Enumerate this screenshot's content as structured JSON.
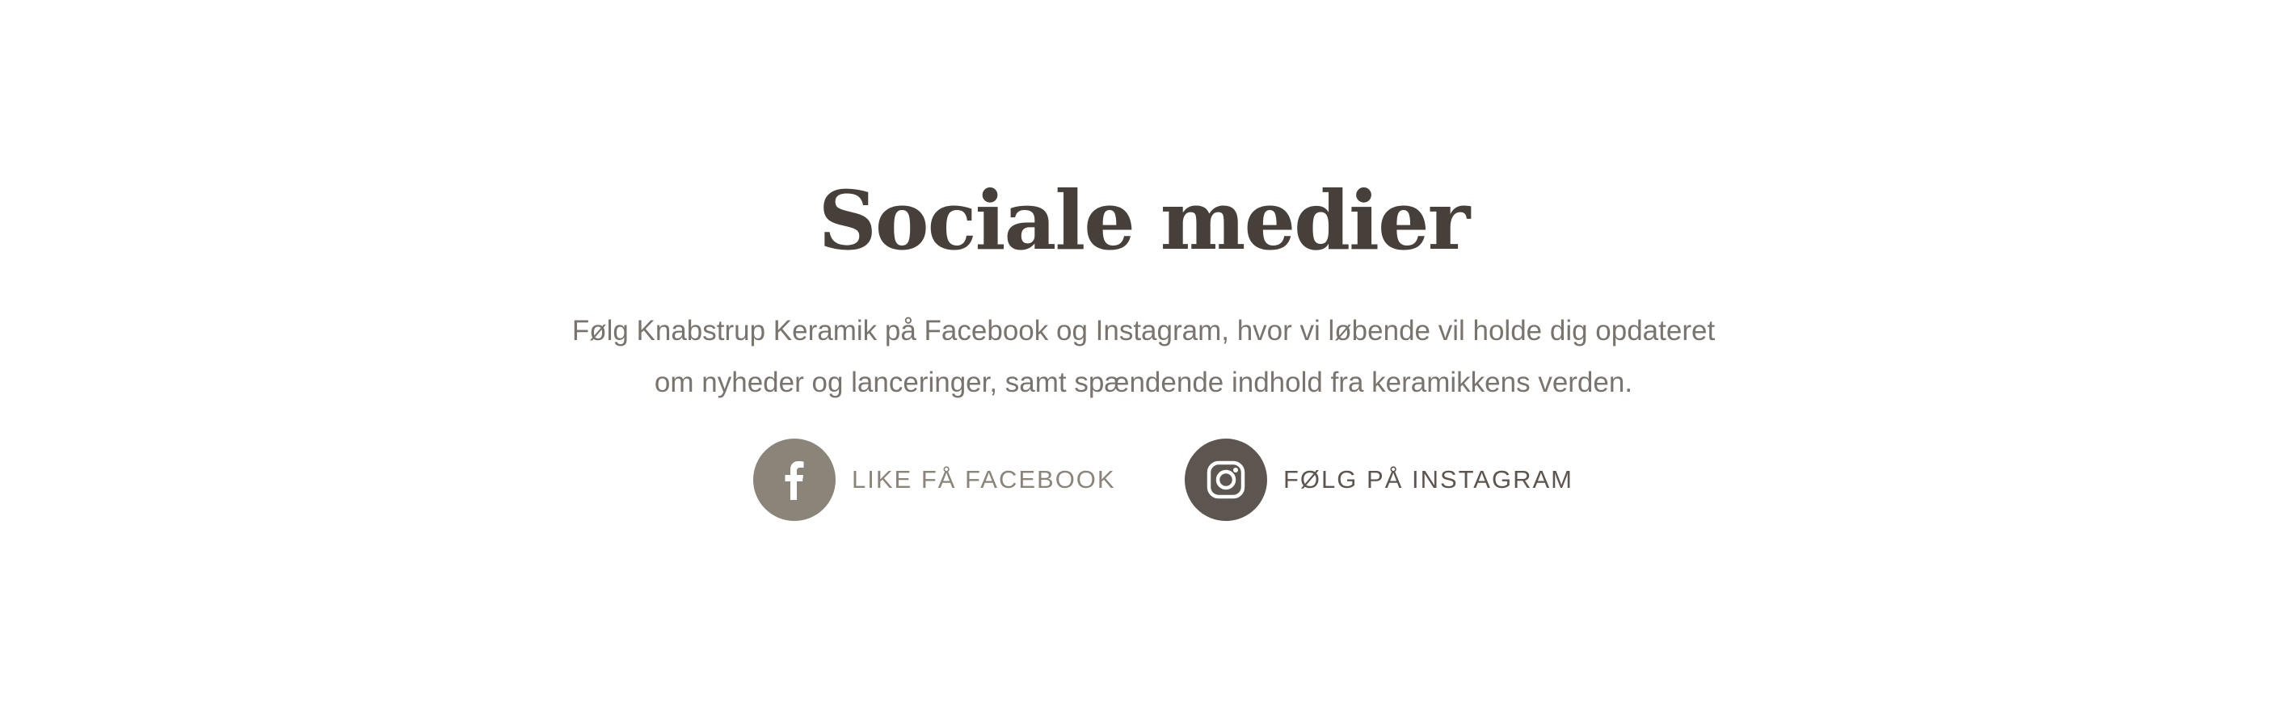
{
  "social": {
    "title": "Sociale medier",
    "description_lines": [
      "Følg Knabstrup Keramik på Facebook og Instagram, hvor vi løbende vil holde dig opdateret",
      "om nyheder og lanceringer, samt spændende indhold fra keramikkens verden."
    ],
    "links": [
      {
        "label": "LIKE FÅ FACEBOOK",
        "icon": "facebook-icon",
        "color": "#8a8479"
      },
      {
        "label": "FØLG PÅ INSTAGRAM",
        "icon": "instagram-icon",
        "color": "#5d554f"
      }
    ]
  },
  "colors": {
    "heading": "#463f3a",
    "body_text": "#7a746e",
    "background": "#ffffff"
  }
}
